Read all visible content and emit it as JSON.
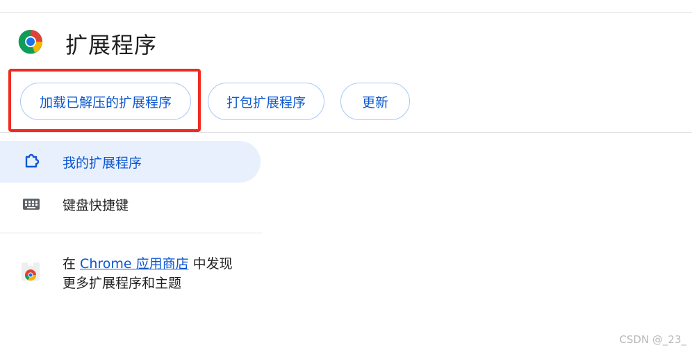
{
  "header": {
    "title": "扩展程序"
  },
  "toolbar": {
    "load_unpacked_label": "加载已解压的扩展程序",
    "pack_label": "打包扩展程序",
    "update_label": "更新"
  },
  "sidebar": {
    "items": [
      {
        "label": "我的扩展程序",
        "selected": true,
        "icon": "puzzle-icon"
      },
      {
        "label": "键盘快捷键",
        "selected": false,
        "icon": "keyboard-icon"
      }
    ],
    "store": {
      "prefix": "在 ",
      "link_text": "Chrome 应用商店",
      "suffix_line1": " 中发现",
      "line2": "更多扩展程序和主题"
    }
  },
  "watermark": "CSDN @_23_",
  "colors": {
    "accent": "#0b57d0",
    "highlight": "#f12a1f",
    "selected_bg": "#e8f0fe"
  }
}
